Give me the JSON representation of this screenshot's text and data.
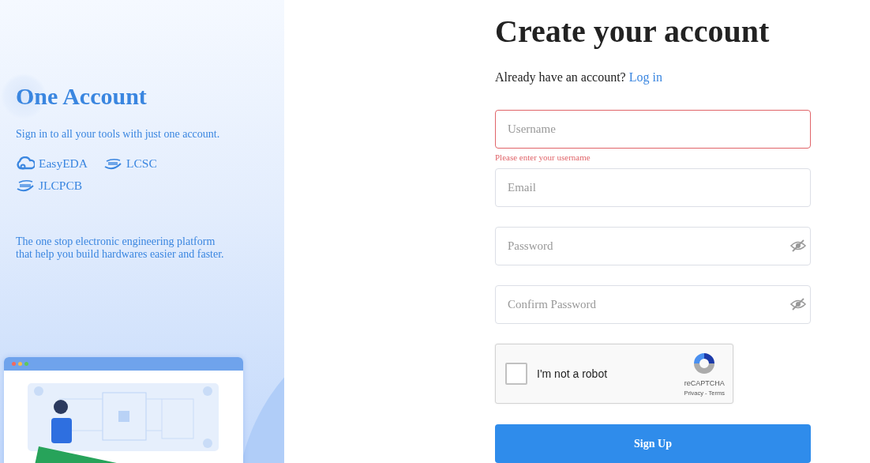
{
  "side": {
    "title": "One Account",
    "subtitle": "Sign in to all your tools with just one account.",
    "brands": [
      {
        "name": "EasyEDA",
        "kind": "cloud"
      },
      {
        "name": "LCSC",
        "kind": "lcsc"
      },
      {
        "name": "JLCPCB",
        "kind": "jlc"
      }
    ],
    "tagline": "The one stop electronic engineering platform\nthat help you build hardwares easier and faster."
  },
  "form": {
    "title": "Create your account",
    "prompt": "Already have an account?",
    "login_link": "Log in",
    "fields": [
      {
        "placeholder": "Username",
        "kind": "text",
        "invalid": true,
        "error": "Please enter your username"
      },
      {
        "placeholder": "Email",
        "kind": "text",
        "invalid": false
      },
      {
        "placeholder": "Password",
        "kind": "password",
        "invalid": false,
        "revealed": false
      },
      {
        "placeholder": "Confirm Password",
        "kind": "password",
        "invalid": false,
        "revealed": false
      }
    ],
    "captcha": {
      "label": "I'm not a robot",
      "checked": false,
      "brand": "reCAPTCHA",
      "links": "Privacy - Terms"
    },
    "submit": "Sign Up"
  }
}
